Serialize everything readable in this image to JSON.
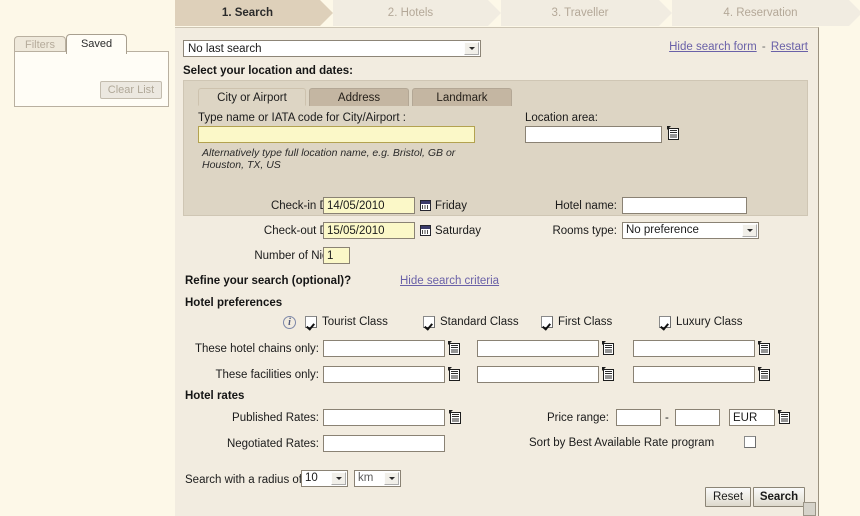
{
  "wizard": {
    "steps": [
      {
        "label": "1. Search",
        "active": true
      },
      {
        "label": "2. Hotels",
        "active": false
      },
      {
        "label": "3. Traveller",
        "active": false
      },
      {
        "label": "4. Reservation",
        "active": false
      }
    ]
  },
  "left_panel": {
    "tabs": [
      {
        "label": "Filters",
        "active": false
      },
      {
        "label": "Saved",
        "active": true
      }
    ],
    "clear_list_label": "Clear List"
  },
  "toolbar": {
    "last_search_value": "No last search",
    "hide_search_form": "Hide search form",
    "separator": "-",
    "restart": "Restart"
  },
  "location_section": {
    "title": "Select your location and dates:",
    "tabs": [
      {
        "label": "City or Airport",
        "active": true
      },
      {
        "label": "Address",
        "active": false
      },
      {
        "label": "Landmark",
        "active": false
      }
    ],
    "city_label": "Type name or IATA code for City/Airport :",
    "city_value": "",
    "city_hint": "Alternatively type full location name, e.g. Bristol, GB or\nHouston, TX, US",
    "location_area_label": "Location area:",
    "location_area_value": ""
  },
  "dates": {
    "checkin_label": "Check-in Date:",
    "checkin_value": "14/05/2010",
    "checkin_day": "Friday",
    "checkout_label": "Check-out Date:",
    "checkout_value": "15/05/2010",
    "checkout_day": "Saturday",
    "nights_label": "Number of Nights:",
    "nights_value": "1"
  },
  "hotel": {
    "name_label": "Hotel name:",
    "name_value": "",
    "rooms_type_label": "Rooms type:",
    "rooms_type_value": "No preference"
  },
  "refine": {
    "title": "Refine your search (optional)?",
    "hide_criteria": "Hide search criteria",
    "preferences_title": "Hotel preferences",
    "classes": [
      {
        "label": "Tourist Class",
        "checked": true
      },
      {
        "label": "Standard Class",
        "checked": true
      },
      {
        "label": "First Class",
        "checked": true
      },
      {
        "label": "Luxury Class",
        "checked": true
      }
    ],
    "chains_label": "These hotel chains only:",
    "chains_values": [
      "",
      "",
      ""
    ],
    "facilities_label": "These facilities only:",
    "facilities_values": [
      "",
      "",
      ""
    ]
  },
  "rates": {
    "title": "Hotel rates",
    "published_label": "Published Rates:",
    "published_value": "",
    "negotiated_label": "Negotiated Rates:",
    "negotiated_value": "",
    "price_range_label": "Price range:",
    "price_min": "",
    "price_dash": "-",
    "price_max": "",
    "currency_value": "EUR",
    "sort_bar_label": "Sort by Best Available Rate program",
    "sort_bar_checked": false
  },
  "radius": {
    "label": "Search with a radius of",
    "value": "10",
    "unit": "km"
  },
  "actions": {
    "reset_label": "Reset",
    "search_label": "Search"
  },
  "colors": {
    "page_background": "#fdf8e8",
    "panel_background": "#f2ece0",
    "location_panel": "#ddd5c4",
    "active_step": "#ded0ba",
    "inactive_step": "#f1ece1",
    "mandatory_field": "#fbf8c8",
    "link": "#6a61a8"
  }
}
